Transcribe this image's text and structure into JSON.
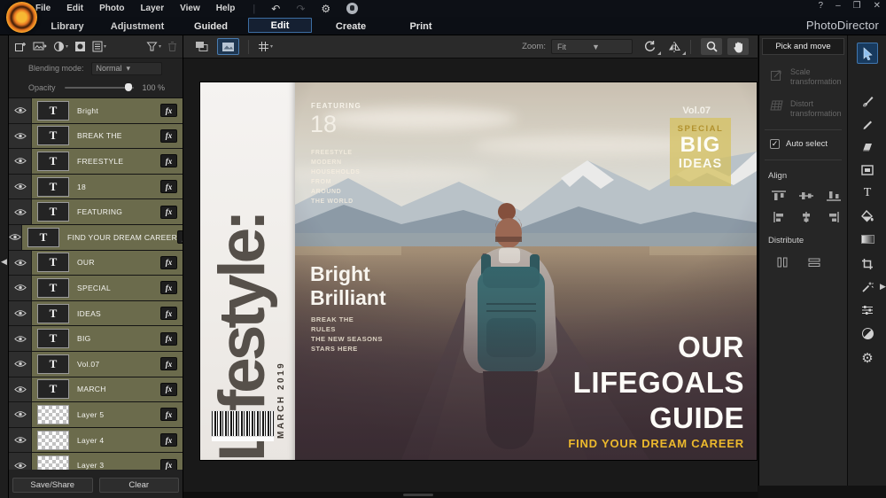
{
  "window": {
    "brand": "PhotoDirector",
    "help": "?",
    "minimize": "–",
    "restore": "❐",
    "close": "✕"
  },
  "menubar": {
    "items": [
      "File",
      "Edit",
      "Photo",
      "Layer",
      "View",
      "Help"
    ]
  },
  "module_tabs": {
    "library": "Library",
    "adjustment": "Adjustment",
    "guided": "Guided",
    "edit": "Edit",
    "create": "Create",
    "print": "Print"
  },
  "layers_panel": {
    "blending_mode_label": "Blending mode:",
    "blending_mode_value": "Normal",
    "opacity_label": "Opacity",
    "opacity_value": "100 %",
    "fx_badge": "fx",
    "layers": [
      {
        "name": "Bright",
        "type": "text"
      },
      {
        "name": "BREAK THE",
        "type": "text"
      },
      {
        "name": "FREESTYLE",
        "type": "text"
      },
      {
        "name": "18",
        "type": "text"
      },
      {
        "name": "FEATURING",
        "type": "text"
      },
      {
        "name": "FIND YOUR DREAM CAREER",
        "type": "text"
      },
      {
        "name": "OUR",
        "type": "text"
      },
      {
        "name": "SPECIAL",
        "type": "text"
      },
      {
        "name": "IDEAS",
        "type": "text"
      },
      {
        "name": "BIG",
        "type": "text"
      },
      {
        "name": "Vol.07",
        "type": "text"
      },
      {
        "name": "MARCH",
        "type": "text"
      },
      {
        "name": "Layer 5",
        "type": "image"
      },
      {
        "name": "Layer 4",
        "type": "image"
      },
      {
        "name": "Layer 3",
        "type": "image"
      }
    ],
    "save_share_label": "Save/Share",
    "clear_label": "Clear"
  },
  "canvas_toolbar": {
    "zoom_label": "Zoom:",
    "zoom_value": "Fit"
  },
  "magazine": {
    "masthead": "Lifestyle:",
    "issue_date": "MARCH 2019",
    "featuring_label": "FEATURING",
    "featuring_number": "18",
    "featuring_lines": [
      "FREESTYLE",
      "MODERN",
      "HOUSEHOLDS",
      "FROM",
      "AROUND",
      "THE WORLD"
    ],
    "headline_word1": "Bright",
    "headline_word2": "Brilliant",
    "headline_sub_lines": [
      "BREAK THE",
      "RULES",
      "THE NEW SEASONS",
      "STARS HERE"
    ],
    "volume": "Vol.07",
    "badge_special": "SPECIAL",
    "badge_big": "BIG",
    "badge_ideas": "IDEAS",
    "cover_lines": [
      "OUR",
      "LIFEGOALS",
      "GUIDE"
    ],
    "cover_sub": "FIND YOUR DREAM CAREER"
  },
  "tool_options": {
    "header": "Pick and move",
    "scale_label": "Scale transformation",
    "distort_label": "Distort transformation",
    "auto_select_label": "Auto select",
    "align_label": "Align",
    "distribute_label": "Distribute"
  },
  "colors": {
    "accent_blue": "#3d6ea3",
    "selected_layer": "#6b6b4c",
    "cover_gold": "#e8b92a"
  }
}
